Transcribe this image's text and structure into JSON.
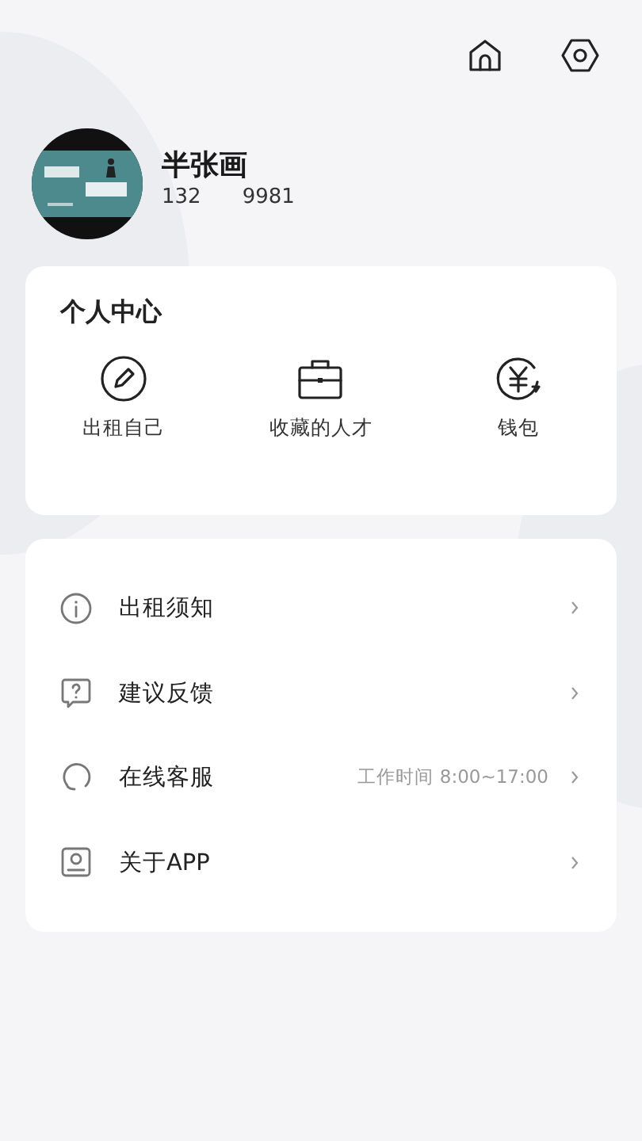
{
  "profile": {
    "name": "半张画",
    "phone_start": "132",
    "phone_end": "9981"
  },
  "personal_center": {
    "title": "个人中心",
    "actions": [
      {
        "label": "出租自己"
      },
      {
        "label": "收藏的人才"
      },
      {
        "label": "钱包"
      }
    ]
  },
  "menu": [
    {
      "label": "出租须知"
    },
    {
      "label": "建议反馈"
    },
    {
      "label": "在线客服",
      "note": "工作时间 8:00~17:00"
    },
    {
      "label": "关于APP"
    }
  ]
}
